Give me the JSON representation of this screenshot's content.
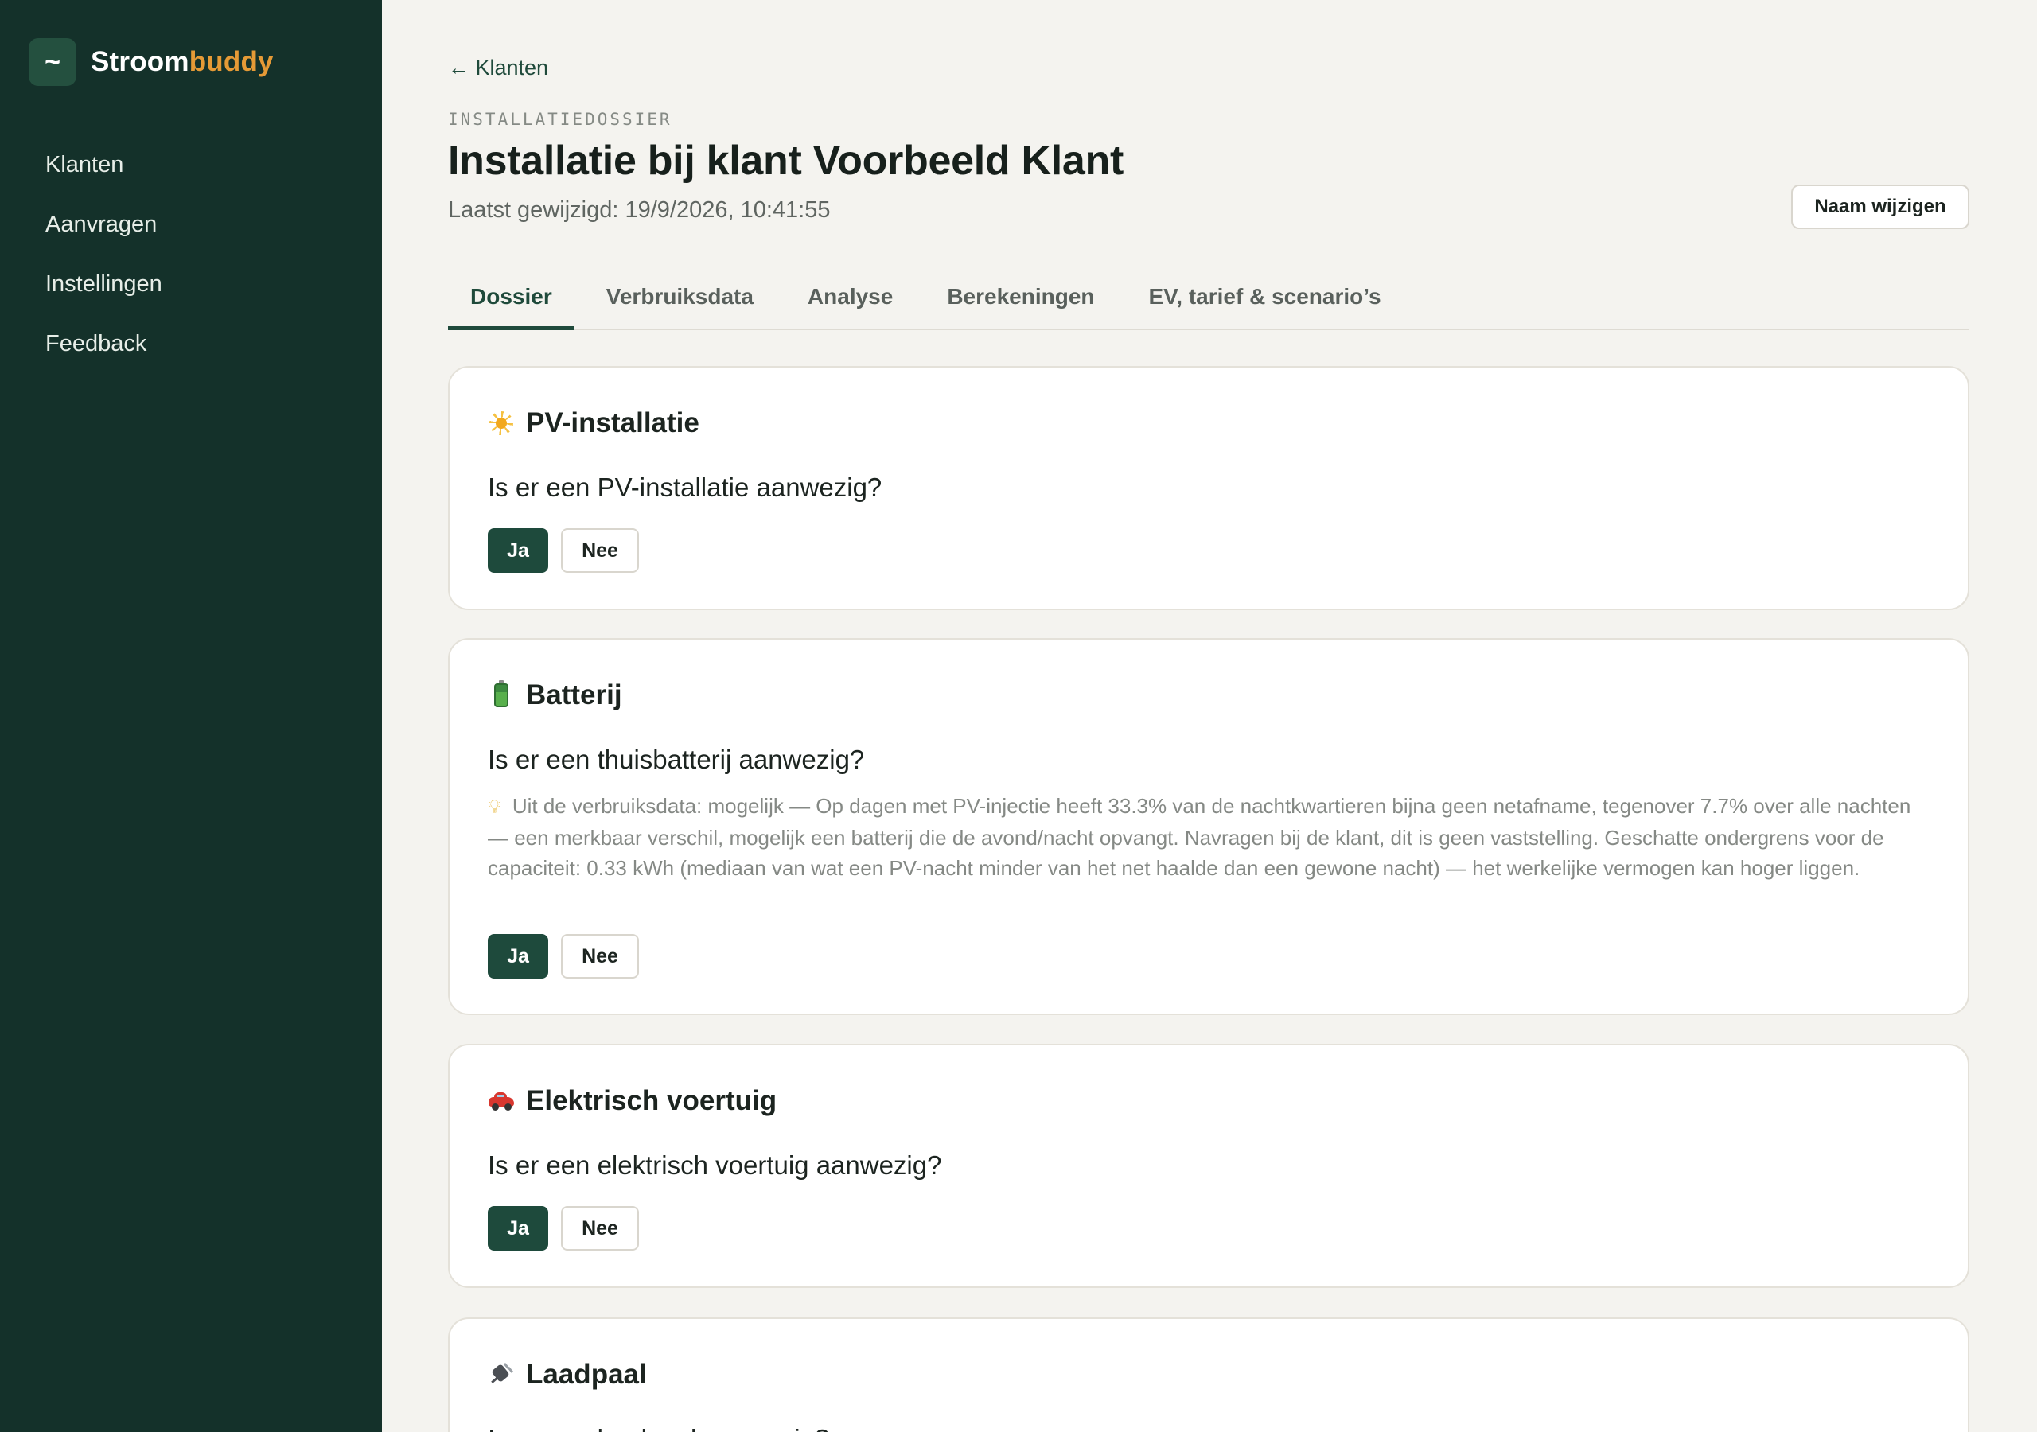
{
  "brand": {
    "logo_glyph": "~",
    "name_part1": "Stroom",
    "name_part2": "buddy",
    "accent_color": "#e59a36"
  },
  "sidebar": {
    "items": [
      {
        "label": "Klanten"
      },
      {
        "label": "Aanvragen"
      },
      {
        "label": "Instellingen"
      },
      {
        "label": "Feedback"
      }
    ]
  },
  "header": {
    "back_label": "← Klanten",
    "eyebrow": "INSTALLATIEDOSSIER",
    "title": "Installatie bij klant Voorbeeld Klant",
    "last_modified": "Laatst gewijzigd: 19/9/2026, 10:41:55",
    "rename_label": "Naam wijzigen"
  },
  "tabs": [
    {
      "label": "Dossier",
      "active": true
    },
    {
      "label": "Verbruiksdata",
      "active": false
    },
    {
      "label": "Analyse",
      "active": false
    },
    {
      "label": "Berekeningen",
      "active": false
    },
    {
      "label": "EV, tarief & scenario’s",
      "active": false
    }
  ],
  "cards": {
    "pv": {
      "icon": "sun-icon",
      "title": "PV-installatie",
      "question": "Is er een PV-installatie aanwezig?",
      "yes_label": "Ja",
      "no_label": "Nee",
      "selected": "Ja"
    },
    "battery": {
      "icon": "battery-icon",
      "title": "Batterij",
      "question": "Is er een thuisbatterij aanwezig?",
      "hint_icon": "lightbulb-icon",
      "hint": "Uit de verbruiksdata: mogelijk — Op dagen met PV-injectie heeft 33.3% van de nachtkwartieren bijna geen netafname, tegenover 7.7% over alle nachten — een merkbaar verschil, mogelijk een batterij die de avond/nacht opvangt. Navragen bij de klant, dit is geen vaststelling. Geschatte ondergrens voor de capaciteit: 0.33 kWh (mediaan van wat een PV-nacht minder van het net haalde dan een gewone nacht) — het werkelijke vermogen kan hoger liggen.",
      "yes_label": "Ja",
      "no_label": "Nee",
      "selected": "Ja"
    },
    "ev": {
      "icon": "car-icon",
      "title": "Elektrisch voertuig",
      "question": "Is er een elektrisch voertuig aanwezig?",
      "yes_label": "Ja",
      "no_label": "Nee",
      "selected": "Ja"
    },
    "charger": {
      "icon": "plug-icon",
      "title": "Laadpaal",
      "question": "Is er een laadpaal aanwezig?"
    }
  },
  "colors": {
    "sidebar_bg": "#14312a",
    "primary": "#1e4a3c",
    "page_bg": "#f4f3ef"
  }
}
